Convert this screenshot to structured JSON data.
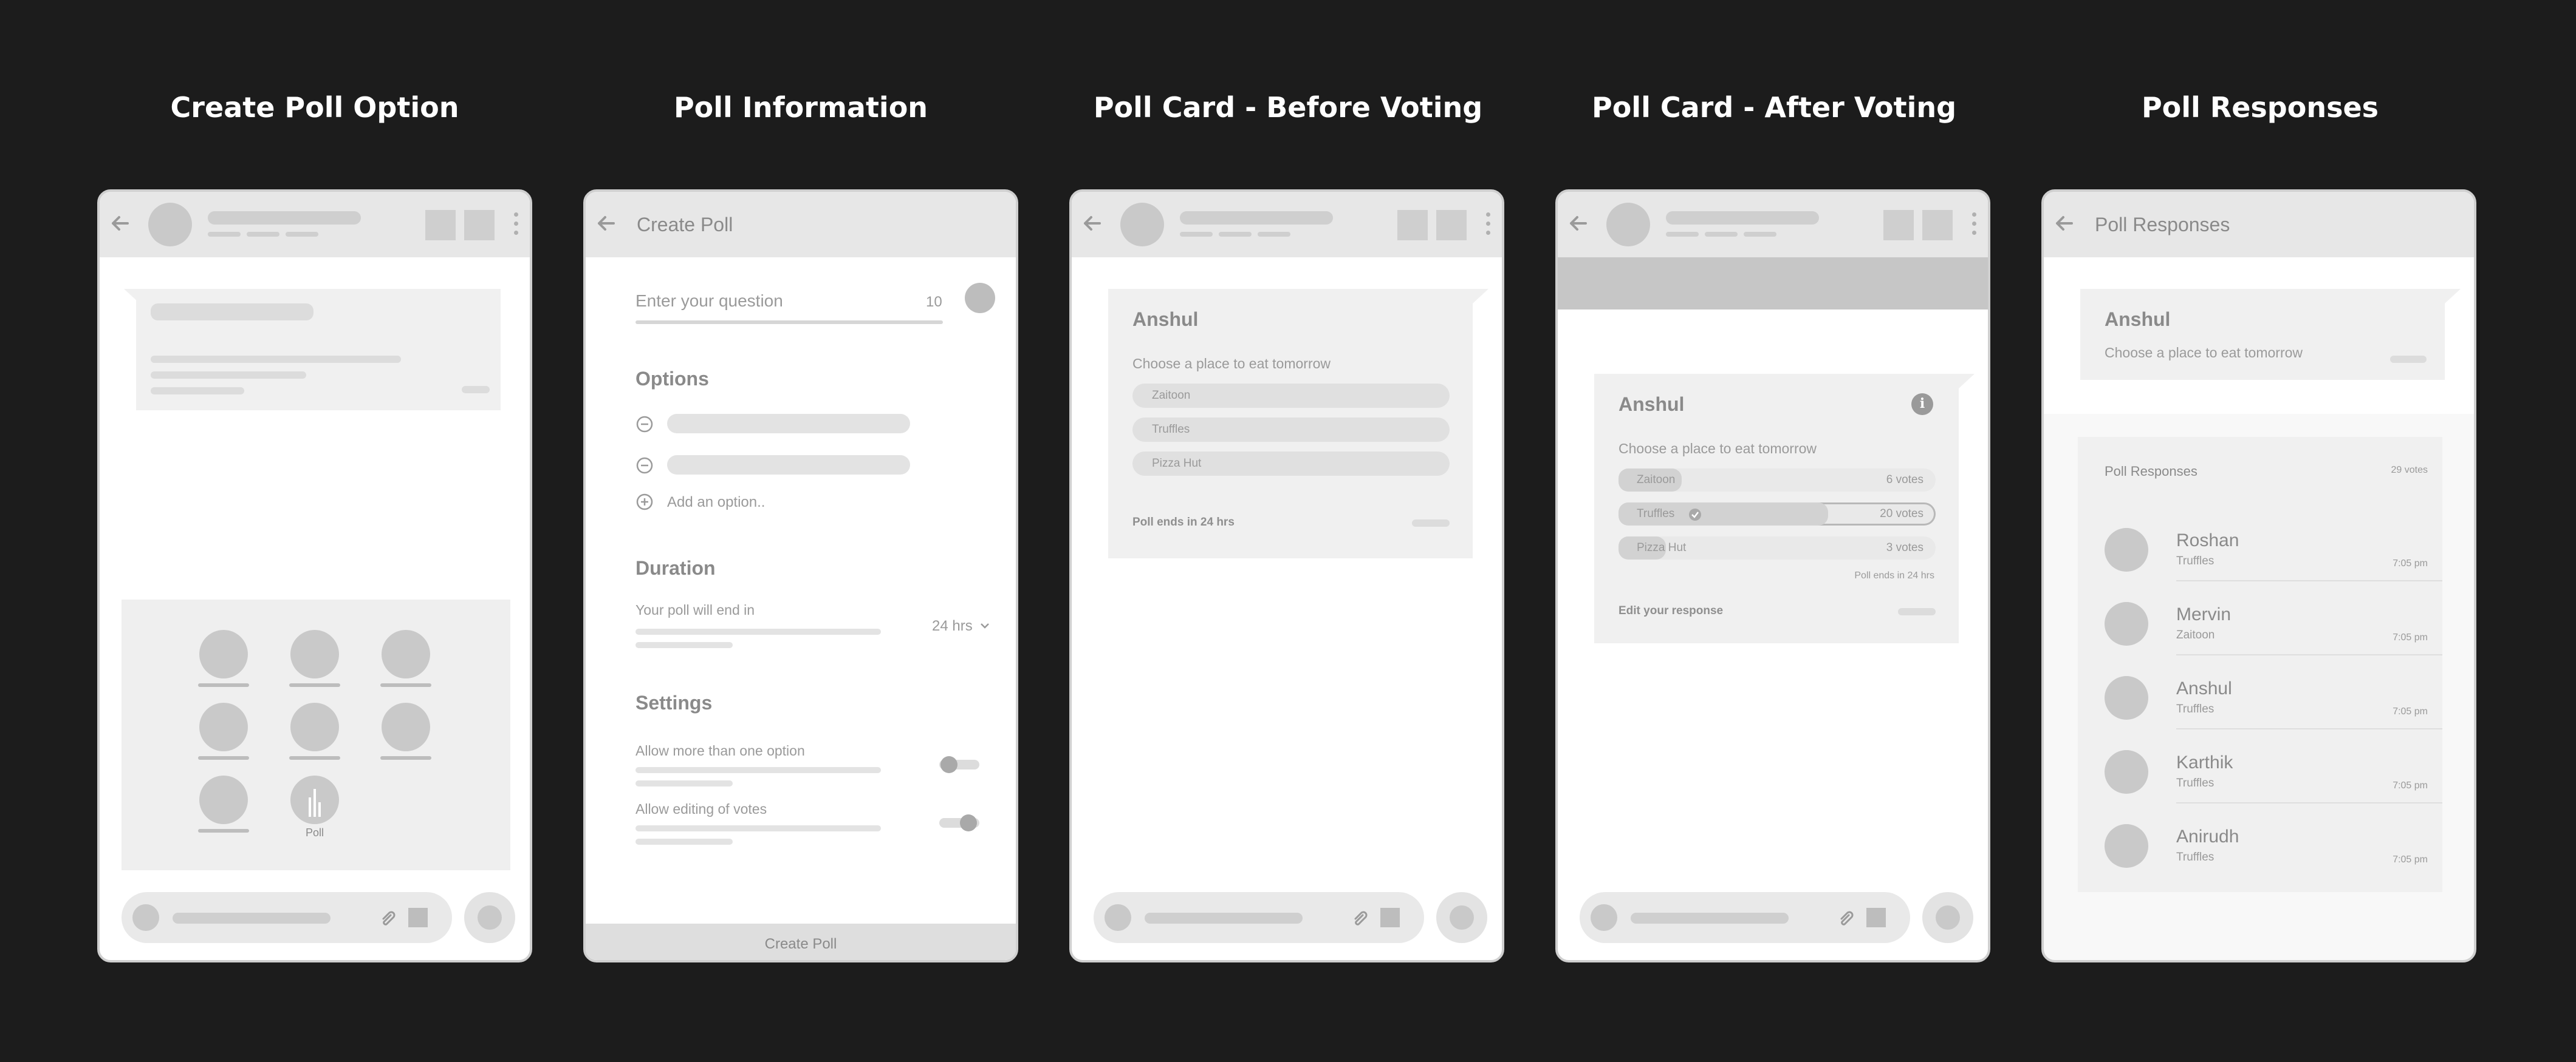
{
  "titles": [
    "Create Poll Option",
    "Poll Information",
    "Poll Card - Before Voting",
    "Poll Card - After Voting",
    "Poll Responses"
  ],
  "screen1": {
    "attach_items": [
      {
        "label": ""
      },
      {
        "label": ""
      },
      {
        "label": ""
      },
      {
        "label": ""
      },
      {
        "label": ""
      },
      {
        "label": ""
      },
      {
        "label": ""
      },
      {
        "label": "Poll"
      }
    ]
  },
  "screen2": {
    "header_title": "Create Poll",
    "question_placeholder": "Enter your question",
    "char_count": "10",
    "options_heading": "Options",
    "add_option": "Add an option..",
    "duration_heading": "Duration",
    "duration_label": "Your poll will end in",
    "duration_value": "24 hrs",
    "settings_heading": "Settings",
    "setting_multiple": "Allow more than one option",
    "setting_editing": "Allow editing of votes",
    "create_button": "Create Poll"
  },
  "screen3": {
    "author": "Anshul",
    "question": "Choose a place to eat tomorrow",
    "options": [
      "Zaitoon",
      "Truffles",
      "Pizza Hut"
    ],
    "ends": "Poll ends in 24 hrs"
  },
  "screen4": {
    "author": "Anshul",
    "question": "Choose a place to eat tomorrow",
    "results": [
      {
        "name": "Zaitoon",
        "votes": "6 votes",
        "share": 0.2,
        "selected": false
      },
      {
        "name": "Truffles",
        "votes": "20 votes",
        "share": 0.66,
        "selected": true
      },
      {
        "name": "Pizza Hut",
        "votes": "3 votes",
        "share": 0.15,
        "selected": false
      }
    ],
    "ends": "Poll ends in 24 hrs",
    "edit_response": "Edit your response"
  },
  "screen5": {
    "header_title": "Poll Responses",
    "author": "Anshul",
    "question": "Choose a place to eat tomorrow",
    "panel_title": "Poll Responses",
    "total_votes": "29 votes",
    "responses": [
      {
        "name": "Roshan",
        "choice": "Truffles",
        "time": "7:05 pm"
      },
      {
        "name": "Mervin",
        "choice": "Zaitoon",
        "time": "7:05 pm"
      },
      {
        "name": "Anshul",
        "choice": "Truffles",
        "time": "7:05 pm"
      },
      {
        "name": "Karthik",
        "choice": "Truffles",
        "time": "7:05 pm"
      },
      {
        "name": "Anirudh",
        "choice": "Truffles",
        "time": "7:05 pm"
      }
    ]
  }
}
